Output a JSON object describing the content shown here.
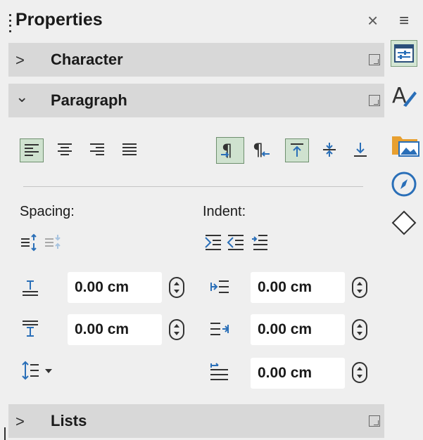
{
  "panel": {
    "title": "Properties",
    "close_glyph": "×",
    "menu_glyph": "≡"
  },
  "sections": {
    "character": {
      "label": "Character",
      "chevron": ">",
      "expanded": false
    },
    "paragraph": {
      "label": "Paragraph",
      "chevron": "⌄",
      "expanded": true
    },
    "lists": {
      "label": "Lists",
      "chevron": ">",
      "expanded": false
    }
  },
  "paragraph": {
    "alignment": {
      "buttons": [
        "align-left-icon",
        "align-center-icon",
        "align-right-icon",
        "align-justify-icon"
      ],
      "selected": "align-left-icon"
    },
    "direction": {
      "buttons": [
        "left-to-right-icon",
        "right-to-left-icon"
      ],
      "selected": "left-to-right-icon"
    },
    "vertical": {
      "buttons": [
        "align-top-icon",
        "align-middle-icon",
        "align-bottom-icon"
      ],
      "selected": "align-top-icon"
    },
    "spacing": {
      "label": "Spacing:",
      "above": "0.00 cm",
      "below": "0.00 cm"
    },
    "indent": {
      "label": "Indent:",
      "before_text": "0.00 cm",
      "after_text": "0.00 cm",
      "first_line": "0.00 cm"
    }
  },
  "tabbar": {
    "items": [
      "properties-icon",
      "styles-icon",
      "gallery-icon",
      "navigator-icon",
      "shapes-icon"
    ],
    "active": "properties-icon"
  },
  "colors": {
    "panel_bg": "#efefef",
    "section_header_bg": "#d8d8d8",
    "selected_bg": "#cfe2cf",
    "accent_blue": "#2a6fb8"
  }
}
